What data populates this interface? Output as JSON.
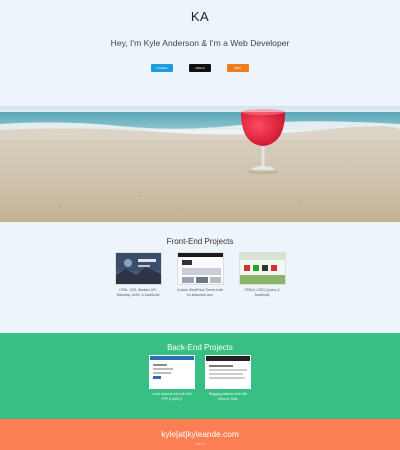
{
  "header": {
    "logo": "KA",
    "tagline": "Hey, I'm Kyle Anderson & I'm a Web Developer",
    "buttons": [
      {
        "label": "LinkedIn",
        "color": "#1e9be0"
      },
      {
        "label": "GitHub",
        "color": "#111111"
      },
      {
        "label": "Blog",
        "color": "#f07c1e"
      }
    ]
  },
  "front_end": {
    "title": "Front-End Projects",
    "projects": [
      {
        "caption": "HTML, CSS, Weather API, Bootstrap, AJAX, & JavaScript"
      },
      {
        "caption": "Custom WordPress Theme build for kickpunch.com"
      },
      {
        "caption": "HTML5, CSS3, jQuery, & JavaScript"
      }
    ]
  },
  "back_end": {
    "title": "Back-End Projects",
    "projects": [
      {
        "caption": "Local treasure site built with PHP & MySQL"
      },
      {
        "caption": "Blogging platform built with Ruby on Rails"
      }
    ]
  },
  "footer": {
    "email": "kyle[at]kyleande.com",
    "small": "Say hi!"
  },
  "colors": {
    "page_bg": "#eef4fb",
    "back_bg": "#38c084",
    "footer_bg": "#fb7f53"
  }
}
